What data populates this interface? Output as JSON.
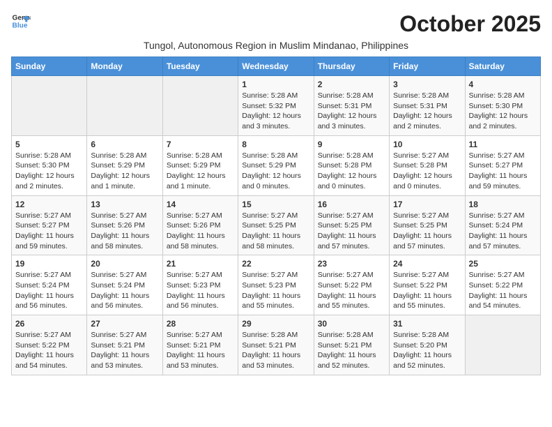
{
  "logo": {
    "line1": "General",
    "line2": "Blue"
  },
  "title": "October 2025",
  "subtitle": "Tungol, Autonomous Region in Muslim Mindanao, Philippines",
  "days_of_week": [
    "Sunday",
    "Monday",
    "Tuesday",
    "Wednesday",
    "Thursday",
    "Friday",
    "Saturday"
  ],
  "weeks": [
    [
      {
        "day": "",
        "info": ""
      },
      {
        "day": "",
        "info": ""
      },
      {
        "day": "",
        "info": ""
      },
      {
        "day": "1",
        "info": "Sunrise: 5:28 AM\nSunset: 5:32 PM\nDaylight: 12 hours\nand 3 minutes."
      },
      {
        "day": "2",
        "info": "Sunrise: 5:28 AM\nSunset: 5:31 PM\nDaylight: 12 hours\nand 3 minutes."
      },
      {
        "day": "3",
        "info": "Sunrise: 5:28 AM\nSunset: 5:31 PM\nDaylight: 12 hours\nand 2 minutes."
      },
      {
        "day": "4",
        "info": "Sunrise: 5:28 AM\nSunset: 5:30 PM\nDaylight: 12 hours\nand 2 minutes."
      }
    ],
    [
      {
        "day": "5",
        "info": "Sunrise: 5:28 AM\nSunset: 5:30 PM\nDaylight: 12 hours\nand 2 minutes."
      },
      {
        "day": "6",
        "info": "Sunrise: 5:28 AM\nSunset: 5:29 PM\nDaylight: 12 hours\nand 1 minute."
      },
      {
        "day": "7",
        "info": "Sunrise: 5:28 AM\nSunset: 5:29 PM\nDaylight: 12 hours\nand 1 minute."
      },
      {
        "day": "8",
        "info": "Sunrise: 5:28 AM\nSunset: 5:29 PM\nDaylight: 12 hours\nand 0 minutes."
      },
      {
        "day": "9",
        "info": "Sunrise: 5:28 AM\nSunset: 5:28 PM\nDaylight: 12 hours\nand 0 minutes."
      },
      {
        "day": "10",
        "info": "Sunrise: 5:27 AM\nSunset: 5:28 PM\nDaylight: 12 hours\nand 0 minutes."
      },
      {
        "day": "11",
        "info": "Sunrise: 5:27 AM\nSunset: 5:27 PM\nDaylight: 11 hours\nand 59 minutes."
      }
    ],
    [
      {
        "day": "12",
        "info": "Sunrise: 5:27 AM\nSunset: 5:27 PM\nDaylight: 11 hours\nand 59 minutes."
      },
      {
        "day": "13",
        "info": "Sunrise: 5:27 AM\nSunset: 5:26 PM\nDaylight: 11 hours\nand 58 minutes."
      },
      {
        "day": "14",
        "info": "Sunrise: 5:27 AM\nSunset: 5:26 PM\nDaylight: 11 hours\nand 58 minutes."
      },
      {
        "day": "15",
        "info": "Sunrise: 5:27 AM\nSunset: 5:25 PM\nDaylight: 11 hours\nand 58 minutes."
      },
      {
        "day": "16",
        "info": "Sunrise: 5:27 AM\nSunset: 5:25 PM\nDaylight: 11 hours\nand 57 minutes."
      },
      {
        "day": "17",
        "info": "Sunrise: 5:27 AM\nSunset: 5:25 PM\nDaylight: 11 hours\nand 57 minutes."
      },
      {
        "day": "18",
        "info": "Sunrise: 5:27 AM\nSunset: 5:24 PM\nDaylight: 11 hours\nand 57 minutes."
      }
    ],
    [
      {
        "day": "19",
        "info": "Sunrise: 5:27 AM\nSunset: 5:24 PM\nDaylight: 11 hours\nand 56 minutes."
      },
      {
        "day": "20",
        "info": "Sunrise: 5:27 AM\nSunset: 5:24 PM\nDaylight: 11 hours\nand 56 minutes."
      },
      {
        "day": "21",
        "info": "Sunrise: 5:27 AM\nSunset: 5:23 PM\nDaylight: 11 hours\nand 56 minutes."
      },
      {
        "day": "22",
        "info": "Sunrise: 5:27 AM\nSunset: 5:23 PM\nDaylight: 11 hours\nand 55 minutes."
      },
      {
        "day": "23",
        "info": "Sunrise: 5:27 AM\nSunset: 5:22 PM\nDaylight: 11 hours\nand 55 minutes."
      },
      {
        "day": "24",
        "info": "Sunrise: 5:27 AM\nSunset: 5:22 PM\nDaylight: 11 hours\nand 55 minutes."
      },
      {
        "day": "25",
        "info": "Sunrise: 5:27 AM\nSunset: 5:22 PM\nDaylight: 11 hours\nand 54 minutes."
      }
    ],
    [
      {
        "day": "26",
        "info": "Sunrise: 5:27 AM\nSunset: 5:22 PM\nDaylight: 11 hours\nand 54 minutes."
      },
      {
        "day": "27",
        "info": "Sunrise: 5:27 AM\nSunset: 5:21 PM\nDaylight: 11 hours\nand 53 minutes."
      },
      {
        "day": "28",
        "info": "Sunrise: 5:27 AM\nSunset: 5:21 PM\nDaylight: 11 hours\nand 53 minutes."
      },
      {
        "day": "29",
        "info": "Sunrise: 5:28 AM\nSunset: 5:21 PM\nDaylight: 11 hours\nand 53 minutes."
      },
      {
        "day": "30",
        "info": "Sunrise: 5:28 AM\nSunset: 5:21 PM\nDaylight: 11 hours\nand 52 minutes."
      },
      {
        "day": "31",
        "info": "Sunrise: 5:28 AM\nSunset: 5:20 PM\nDaylight: 11 hours\nand 52 minutes."
      },
      {
        "day": "",
        "info": ""
      }
    ]
  ]
}
